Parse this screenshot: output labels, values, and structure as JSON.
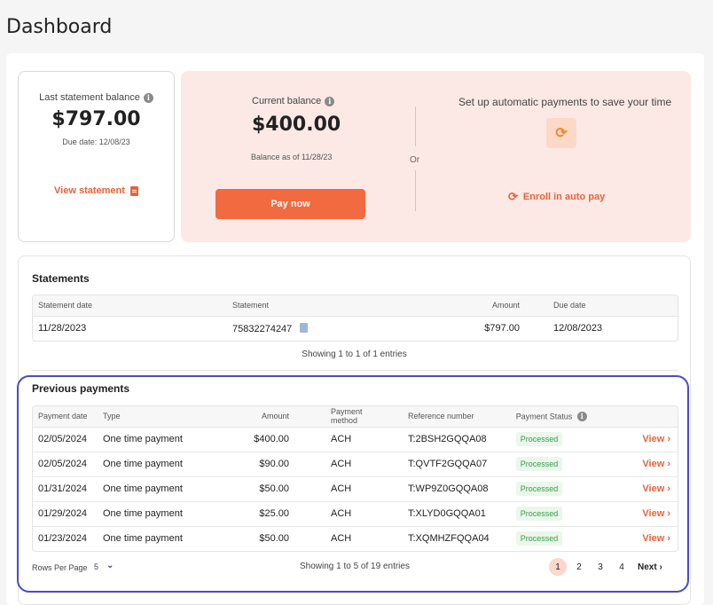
{
  "page_title": "Dashboard",
  "last_statement": {
    "label": "Last statement balance",
    "amount": "$797.00",
    "due": "Due date: 12/08/23",
    "link": "View statement"
  },
  "current": {
    "label": "Current balance",
    "amount": "$400.00",
    "as_of": "Balance as of  11/28/23",
    "pay_button": "Pay now"
  },
  "or_text": "Or",
  "autopay": {
    "text": "Set up automatic payments to save your time",
    "enroll": "Enroll in auto pay"
  },
  "statements": {
    "title": "Statements",
    "columns": [
      "Statement date",
      "Statement",
      "Amount",
      "Due date"
    ],
    "rows": [
      [
        "11/28/2023",
        "75832274247",
        "$797.00",
        "12/08/2023"
      ]
    ],
    "showing": "Showing 1 to 1 of 1 entries"
  },
  "payments": {
    "title": "Previous payments",
    "columns": [
      "Payment date",
      "Type",
      "Amount",
      "Payment method",
      "Reference number",
      "Payment Status"
    ],
    "rows": [
      [
        "02/05/2024",
        "One time payment",
        "$400.00",
        "ACH",
        "T:2BSH2GQQA08",
        "Processed",
        "View"
      ],
      [
        "02/05/2024",
        "One time payment",
        "$90.00",
        "ACH",
        "T:QVTF2GQQA07",
        "Processed",
        "View"
      ],
      [
        "01/31/2024",
        "One time payment",
        "$50.00",
        "ACH",
        "T:WP9Z0GQQA08",
        "Processed",
        "View"
      ],
      [
        "01/29/2024",
        "One time payment",
        "$25.00",
        "ACH",
        "T:XLYD0GQQA01",
        "Processed",
        "View"
      ],
      [
        "01/23/2024",
        "One time payment",
        "$50.00",
        "ACH",
        "T:XQMHZFQQA04",
        "Processed",
        "View"
      ]
    ],
    "rows_per_page_label": "Rows Per Page",
    "rows_per_page_value": "5",
    "showing": "Showing 1 to 5 of 19 entries",
    "pages": [
      "1",
      "2",
      "3",
      "4"
    ],
    "next": "Next"
  },
  "colors": {
    "accent": "#f26a3f",
    "highlight": "#4a4dbf",
    "status_green": "#3b9b4c"
  }
}
